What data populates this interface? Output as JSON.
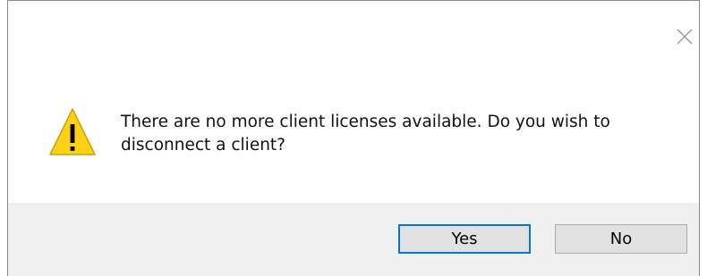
{
  "dialog": {
    "close_icon": "close-icon",
    "warning_icon": "warning-triangle-icon",
    "message": "There are no more client licenses available. Do you wish to disconnect a client?",
    "buttons": {
      "yes": "Yes",
      "no": "No"
    },
    "colors": {
      "footer_bg": "#f0f0f0",
      "default_button_border": "#0078d7",
      "warning_fill": "#fcd116"
    }
  }
}
